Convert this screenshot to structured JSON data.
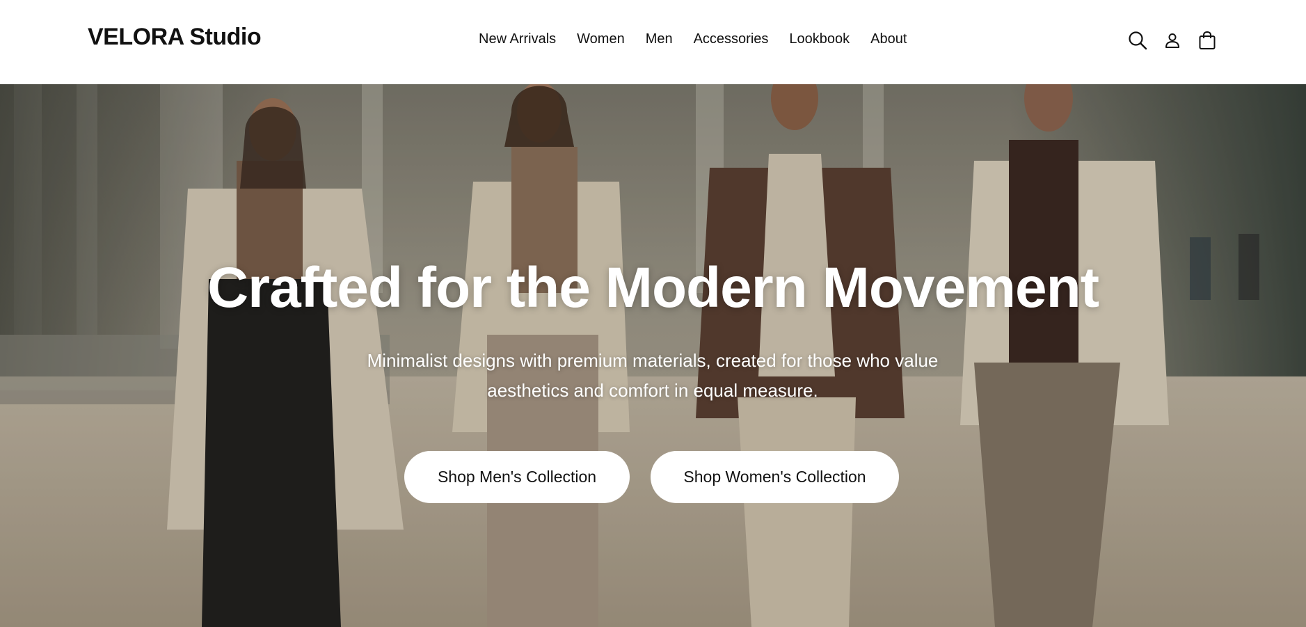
{
  "header": {
    "logo": "VELORA Studio",
    "nav": [
      "New Arrivals",
      "Women",
      "Men",
      "Accessories",
      "Lookbook",
      "About"
    ],
    "icons": [
      "search-icon",
      "user-icon",
      "shopping-bag-icon"
    ]
  },
  "hero": {
    "title": "Crafted for the Modern Movement",
    "subtitle_line1": "Minimalist designs with premium materials, created for those who value",
    "subtitle_line2": "aesthetics and comfort in equal measure.",
    "cta_men": "Shop Men's Collection",
    "cta_women": "Shop Women's Collection"
  },
  "colors": {
    "text": "#111111",
    "header_bg": "#ffffff",
    "button_bg": "#ffffff",
    "hero_text": "#ffffff"
  }
}
